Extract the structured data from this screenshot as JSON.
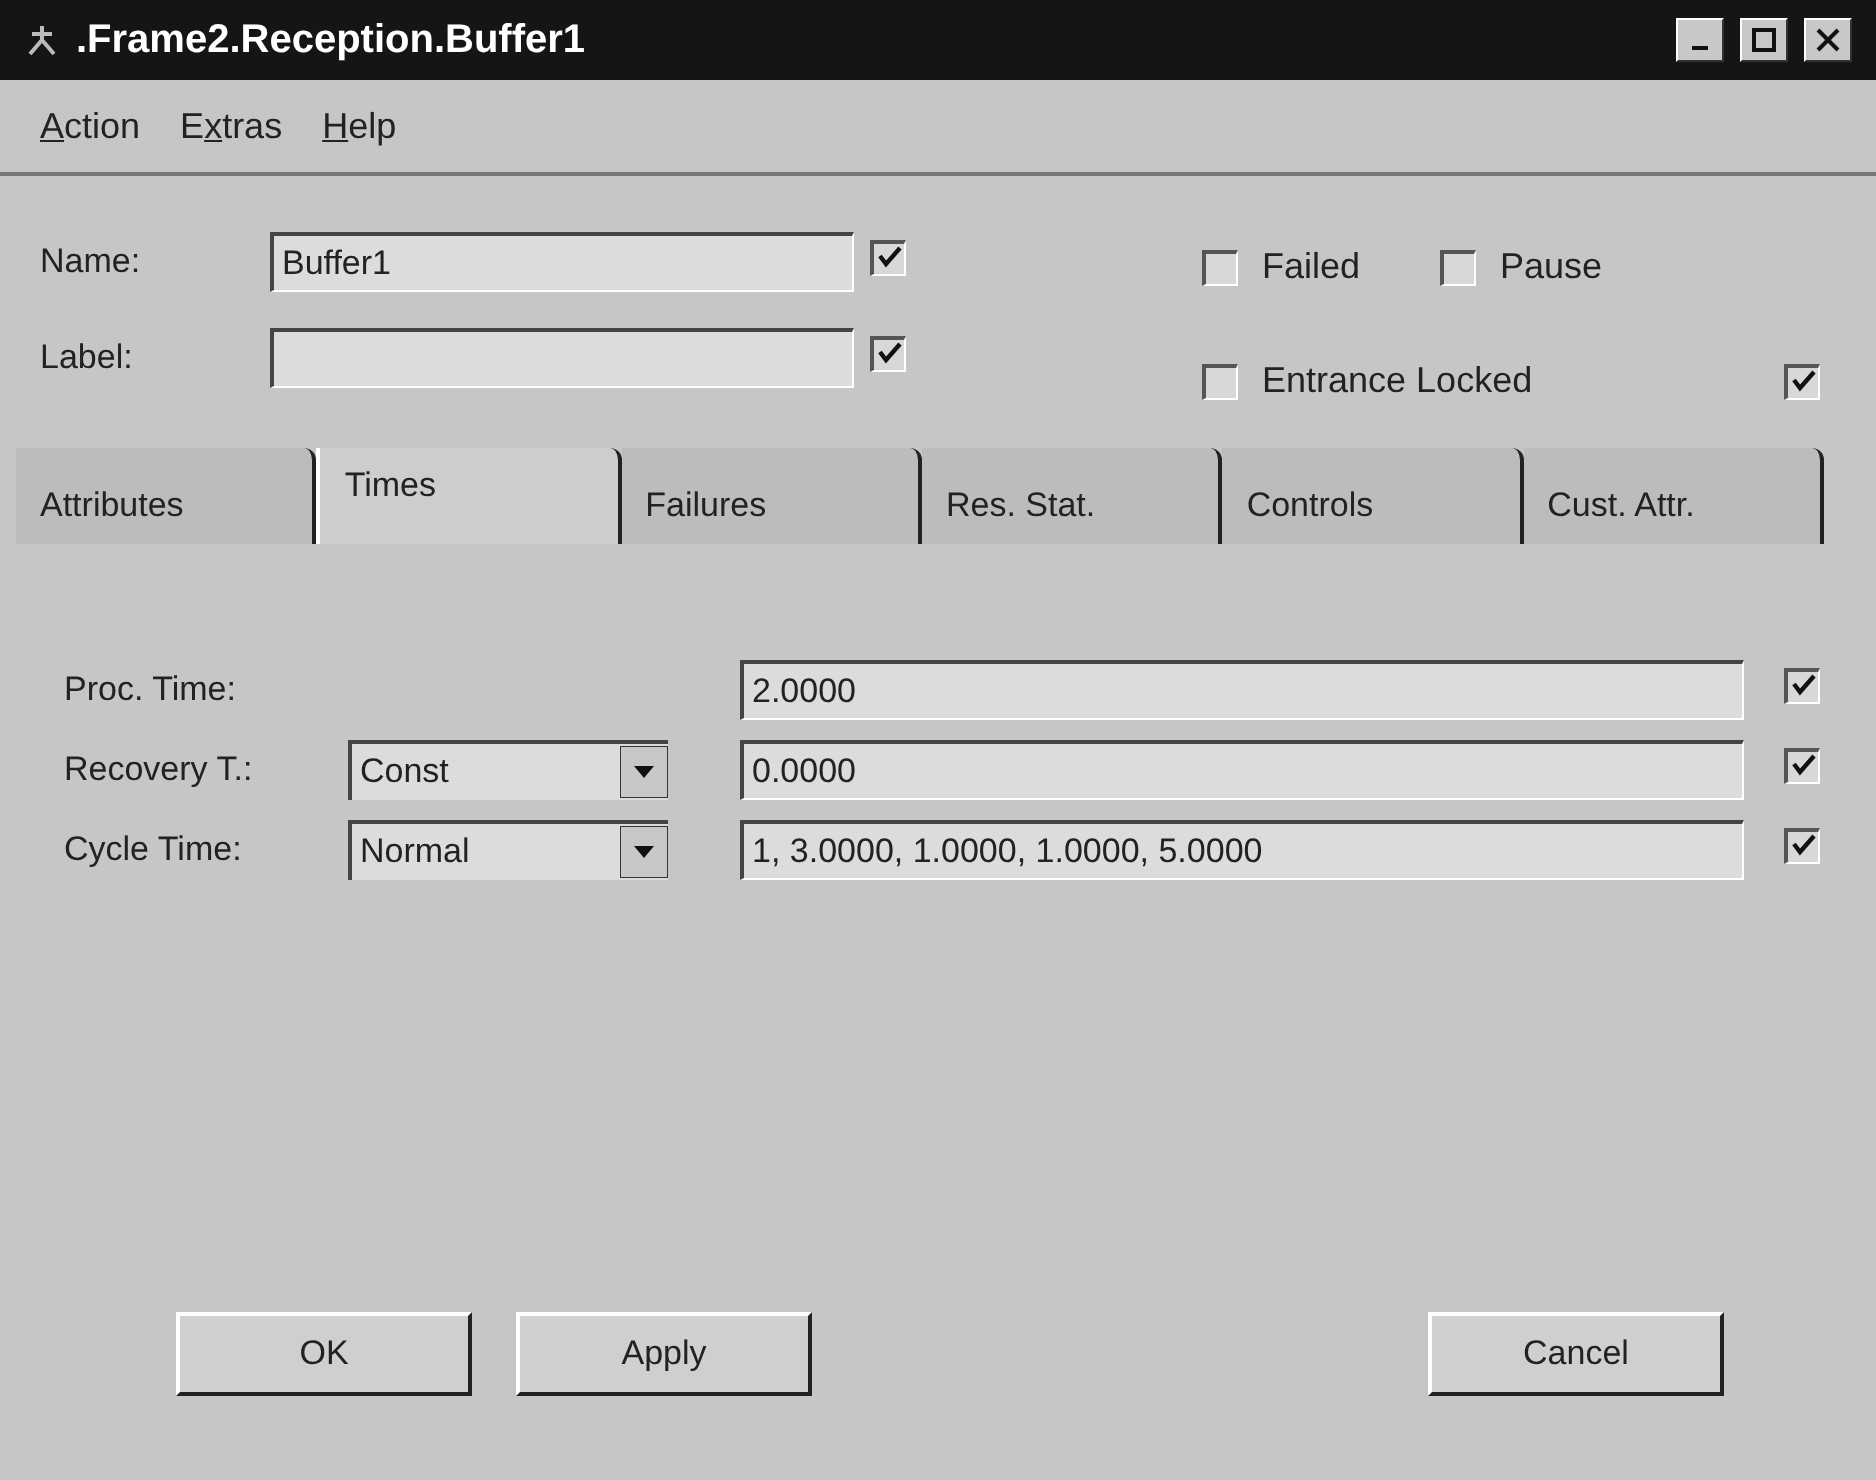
{
  "window": {
    "title": ".Frame2.Reception.Buffer1"
  },
  "menu": [
    "Action",
    "Extras",
    "Help"
  ],
  "fields": [
    {
      "label": "Name:",
      "value": "Buffer1",
      "checked": true
    },
    {
      "label": "Label:",
      "checked": true
    }
  ],
  "options": [
    {
      "label": "Failed",
      "checked": false
    },
    {
      "label": "Pause",
      "checked": false
    },
    {
      "label": "Entrance Locked",
      "checked": false
    },
    {
      "checked": true
    }
  ],
  "tabs": [
    {
      "label": "Attributes",
      "selected": false
    },
    {
      "label": "Times",
      "selected": true
    },
    {
      "label": "Failures",
      "selected": false
    },
    {
      "label": "Res. Stat.",
      "selected": false
    },
    {
      "label": "Controls",
      "selected": false
    },
    {
      "label": "Cust. Attr.",
      "selected": false
    }
  ],
  "time_rows": [
    {
      "label": "Proc. Time:",
      "value": "2.0000",
      "checked": true
    },
    {
      "label": "Recovery T.:",
      "distribution": "Const",
      "value": "0.0000",
      "checked": true
    },
    {
      "label": "Cycle Time:",
      "distribution": "Normal",
      "value": "1, 3.0000, 1.0000, 1.0000, 5.0000",
      "checked": true
    }
  ],
  "buttons": [
    "OK",
    "Apply",
    "Cancel"
  ]
}
